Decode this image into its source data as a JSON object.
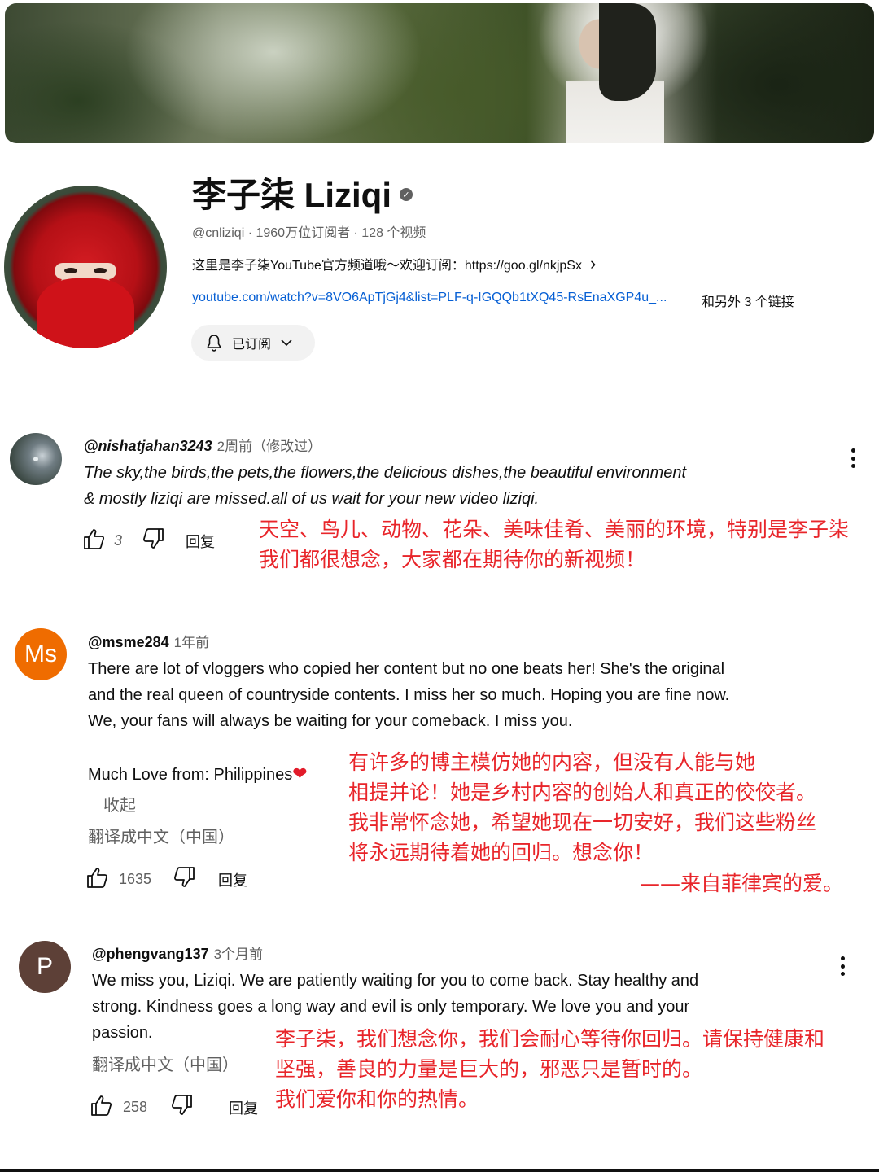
{
  "channel": {
    "name": "李子柒 Liziqi",
    "meta": "@cnliziqi · 1960万位订阅者 · 128 个视频",
    "description": "这里是李子柒YouTube官方频道哦～欢迎订阅：https://goo.gl/nkjpSx",
    "link": "youtube.com/watch?v=8VO6ApTjGj4&list=PLF-q-IGQQb1tXQ45-RsEnaXGP4u_...",
    "more_links": "和另外 3 个链接",
    "subscribe_label": "已订阅"
  },
  "comments": [
    {
      "avatar_letter": "",
      "handle": "@nishatjahan3243",
      "time": "2周前（修改过）",
      "text": [
        "The sky,the birds,the pets,the flowers,the delicious dishes,the beautiful environment",
        "& mostly liziqi are missed.all of us wait for your new video liziqi."
      ],
      "likes": "3",
      "reply": "回复",
      "annotation": [
        "天空、鸟儿、动物、花朵、美味佳肴、美丽的环境，特别是李子柒",
        "我们都很想念，大家都在期待你的新视频！"
      ]
    },
    {
      "avatar_letter": "Ms",
      "handle": "@msme284",
      "time": "1年前",
      "text": [
        "There are lot of vloggers who copied her content but no one beats her! She's the original",
        "and the real queen of countryside contents. I miss her so much. Hoping you are fine now.",
        "We, your fans will always be waiting for your comeback. I miss you."
      ],
      "extra_line": "Much Love from: Philippines",
      "collapse": "收起",
      "translate": "翻译成中文（中国）",
      "likes": "1635",
      "reply": "回复",
      "annotation": [
        "有许多的博主模仿她的内容，但没有人能与她",
        "相提并论！她是乡村内容的创始人和真正的佼佼者。",
        "我非常怀念她，希望她现在一切安好，我们这些粉丝",
        "将永远期待着她的回归。想念你！",
        "——来自菲律宾的爱。"
      ]
    },
    {
      "avatar_letter": "P",
      "handle": "@phengvang137",
      "time": "3个月前",
      "text": [
        "We miss you, Liziqi. We are patiently waiting for you to come back. Stay healthy and",
        "strong. Kindness goes a long way and evil is only temporary. We love you and your",
        "passion."
      ],
      "translate": "翻译成中文（中国）",
      "likes": "258",
      "reply": "回复",
      "annotation": [
        "李子柒，我们想念你，我们会耐心等待你回归。请保持健康和",
        "坚强，善良的力量是巨大的，邪恶只是暂时的。",
        "我们爱你和你的热情。"
      ]
    }
  ],
  "colors": {
    "annotation_red": "#e8252a",
    "link_blue": "#065fd4",
    "avatar_orange": "#ef6c00",
    "avatar_brown": "#5d4037"
  },
  "icons": [
    "verified-icon",
    "chevron-right-icon",
    "bell-icon",
    "chevron-down-icon",
    "thumb-up-icon",
    "thumb-down-icon",
    "more-vert-icon",
    "heart-icon"
  ]
}
